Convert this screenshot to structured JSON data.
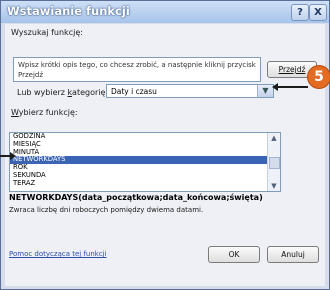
{
  "window": {
    "title": "Wstawianie funkcji",
    "help_label": "?",
    "close_label": "X"
  },
  "search": {
    "label": "Wyszukaj funkcję:",
    "text": "Wpisz krótki opis tego, co chcesz zrobić, a następnie kliknij przycisk Przejdź",
    "go_label": "Przejdź"
  },
  "category": {
    "label_prefix": "Lub wybierz ",
    "label_accel": "k",
    "label_suffix": "ategorię:",
    "value": "Daty i czasu"
  },
  "functions": {
    "label_accel": "W",
    "label_rest": "ybierz funkcję:",
    "items": [
      "GODZINA",
      "MIESIĄC",
      "MINUTA",
      "NETWORKDAYS",
      "ROK",
      "SEKUNDA",
      "TERAZ"
    ],
    "selected_index": 3
  },
  "description": {
    "signature": "NETWORKDAYS(data_początkowa;data_końcowa;święta)",
    "text": "Zwraca liczbę dni roboczych pomiędzy dwiema datami."
  },
  "footer": {
    "help_link": "Pomoc dotycząca tej funkcji",
    "ok_label": "OK",
    "cancel_label": "Anuluj"
  },
  "callout": {
    "number": "5",
    "color": "#e46b22"
  }
}
